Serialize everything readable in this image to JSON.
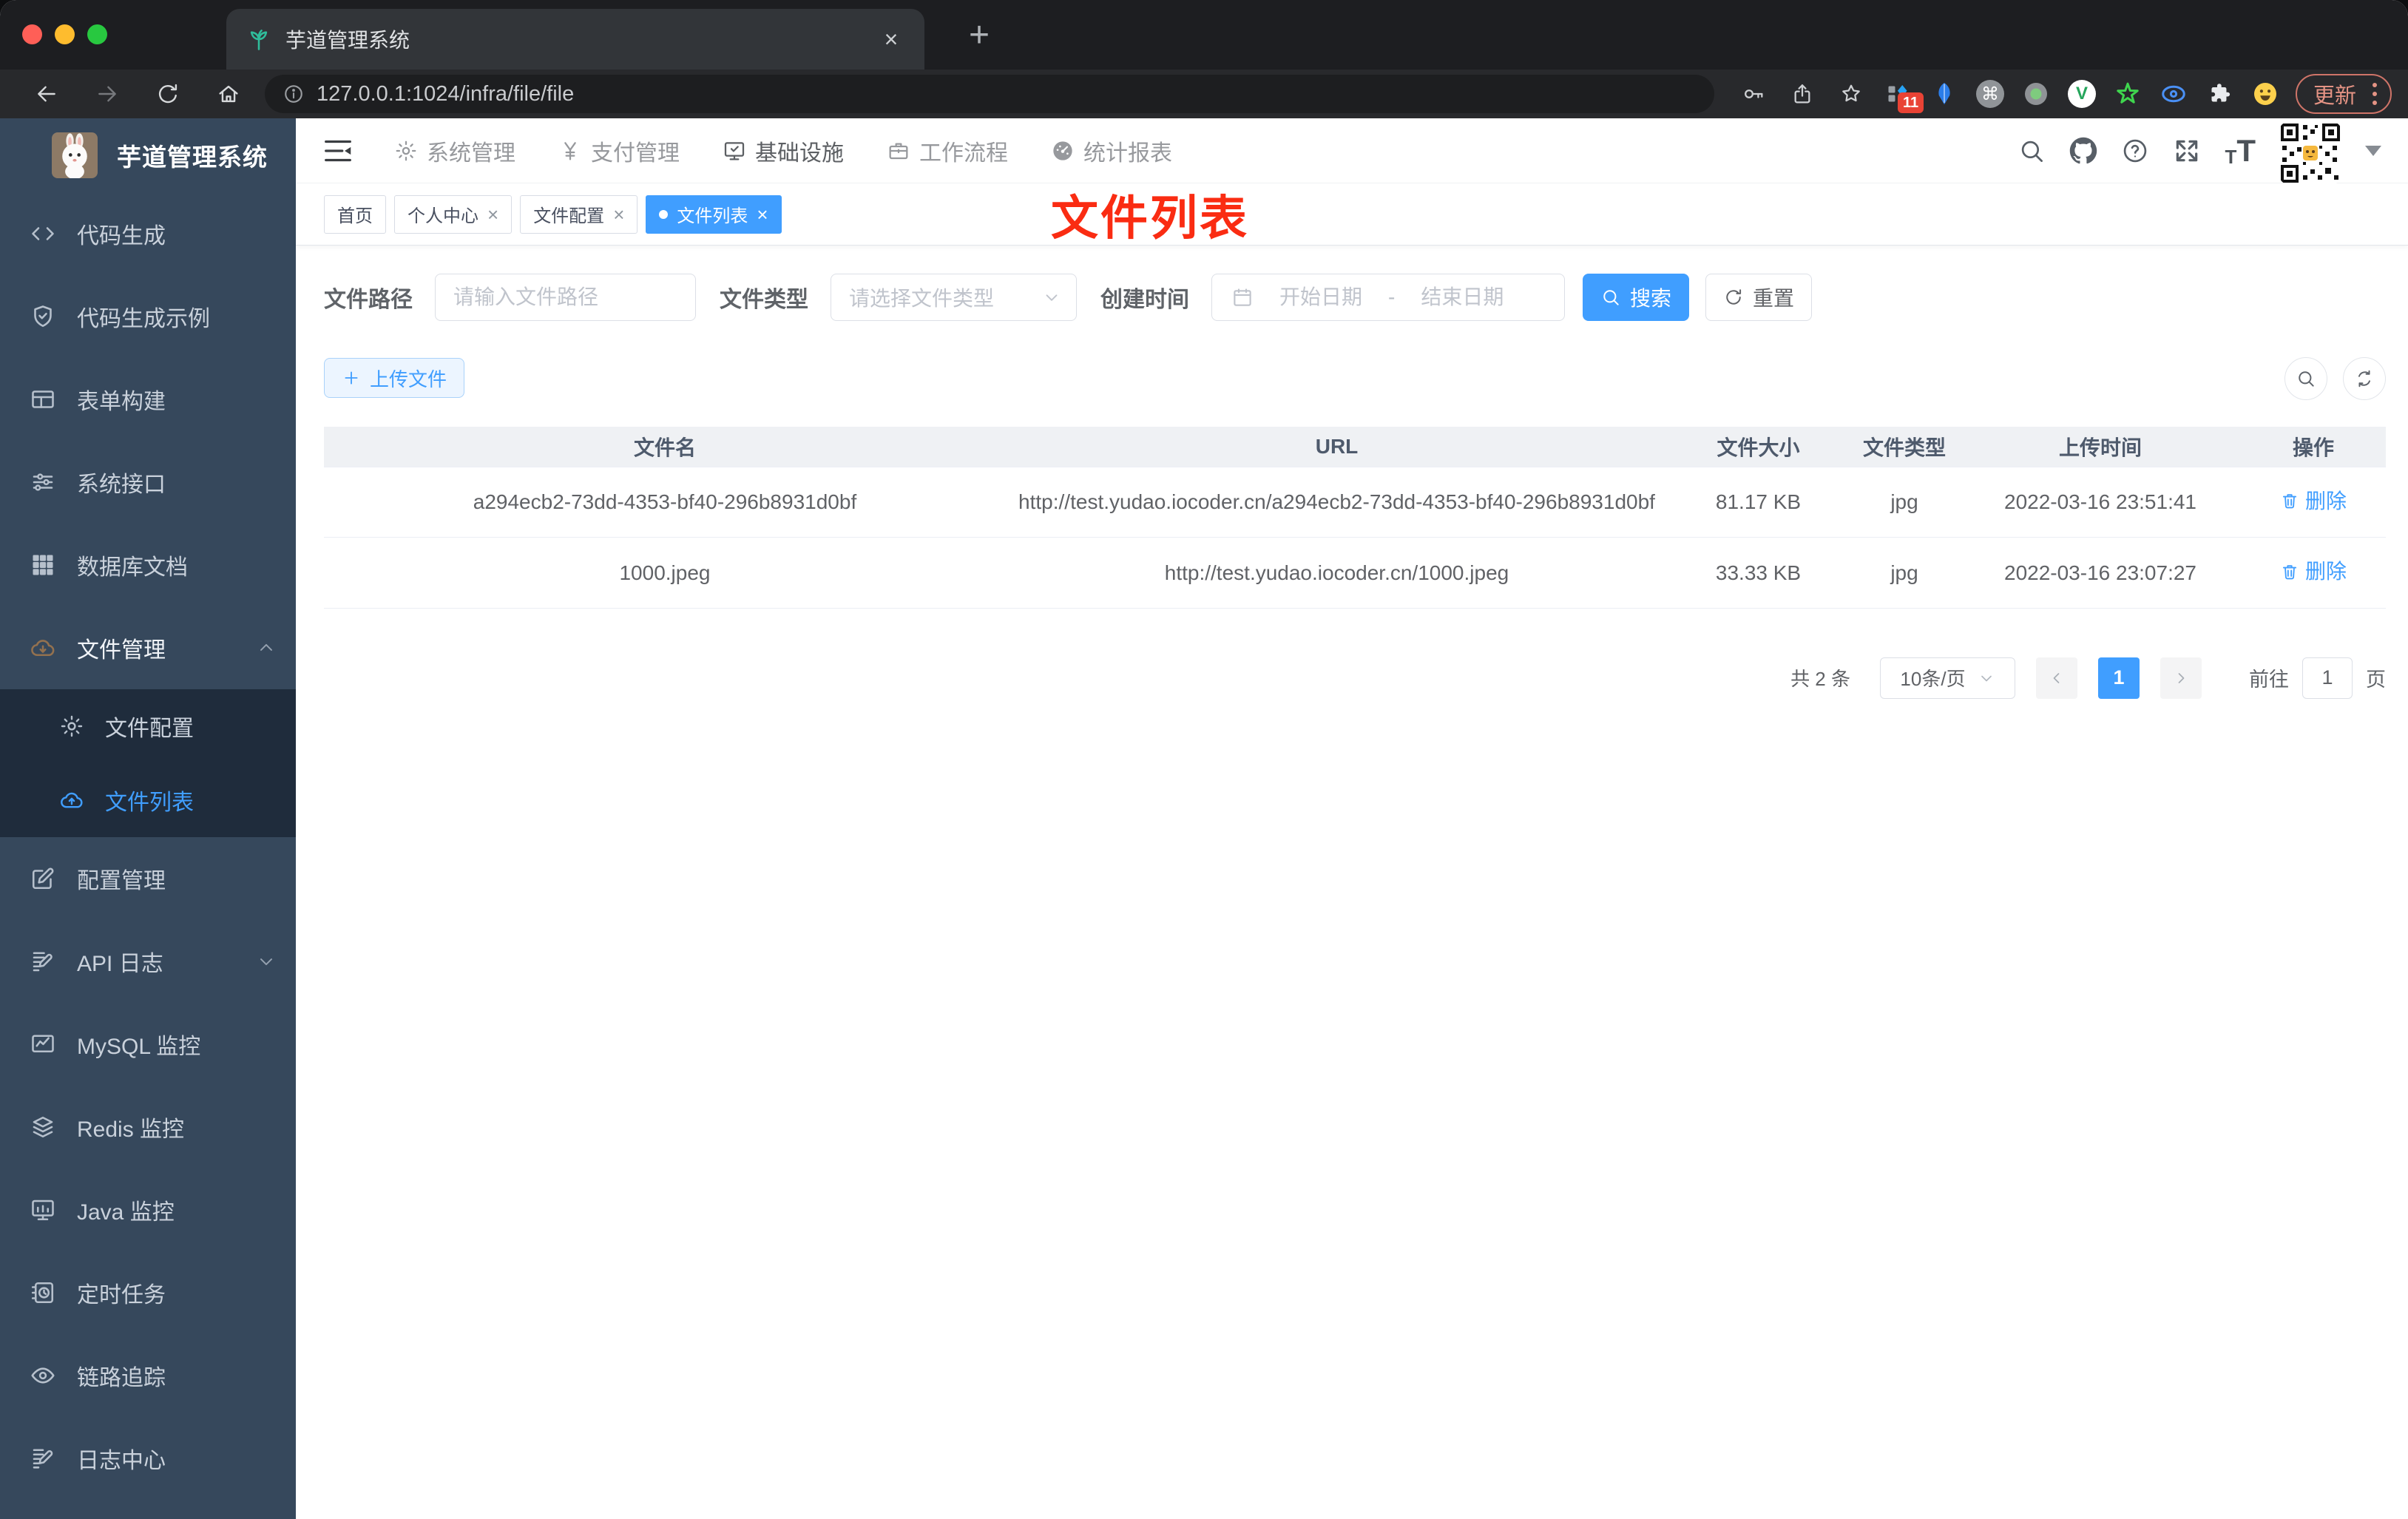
{
  "colors": {
    "accent": "#409eff",
    "annotation_red": "#fa2c12",
    "sidebar_bg": "#36485c",
    "sidebar_submenu_bg": "#1f2c3c",
    "tab_bar_bg": "#1d1e21",
    "upload_button_bg": "#ecf5ff",
    "table_header_bg": "#eff1f4"
  },
  "glyphs": {
    "close": "×",
    "plus": "+",
    "prev": "‹",
    "next": "›",
    "cmd": "⌘",
    "vue": "V",
    "font_small": "T",
    "font_big": "T"
  },
  "browser": {
    "tab_title": "芋道管理系统",
    "url": "127.0.0.1:1024/infra/file/file",
    "extension_badge": "11",
    "update_label": "更新"
  },
  "topnav": {
    "items": [
      {
        "label": "系统管理"
      },
      {
        "label": "支付管理"
      },
      {
        "label": "基础设施"
      },
      {
        "label": "工作流程"
      },
      {
        "label": "统计报表"
      }
    ]
  },
  "sidebar": {
    "title": "芋道管理系统",
    "items": [
      {
        "label": "代码生成"
      },
      {
        "label": "代码生成示例"
      },
      {
        "label": "表单构建"
      },
      {
        "label": "系统接口"
      },
      {
        "label": "数据库文档"
      },
      {
        "label": "文件管理"
      },
      {
        "label": "文件配置"
      },
      {
        "label": "文件列表"
      },
      {
        "label": "配置管理"
      },
      {
        "label": "API 日志"
      },
      {
        "label": "MySQL 监控"
      },
      {
        "label": "Redis 监控"
      },
      {
        "label": "Java 监控"
      },
      {
        "label": "定时任务"
      },
      {
        "label": "链路追踪"
      },
      {
        "label": "日志中心"
      }
    ]
  },
  "tags": {
    "items": [
      {
        "label": "首页"
      },
      {
        "label": "个人中心"
      },
      {
        "label": "文件配置"
      },
      {
        "label": "文件列表"
      }
    ]
  },
  "annotation": "文件列表",
  "filter": {
    "path_label": "文件路径",
    "path_placeholder": "请输入文件路径",
    "type_label": "文件类型",
    "type_placeholder": "请选择文件类型",
    "date_label": "创建时间",
    "date_start_placeholder": "开始日期",
    "date_separator": "-",
    "date_end_placeholder": "结束日期",
    "search_label": "搜索",
    "reset_label": "重置"
  },
  "toolbar": {
    "upload_label": "上传文件"
  },
  "table": {
    "columns": [
      "文件名",
      "URL",
      "文件大小",
      "文件类型",
      "上传时间",
      "操作"
    ],
    "rows": [
      {
        "name": "a294ecb2-73dd-4353-bf40-296b8931d0bf",
        "url": "http://test.yudao.iocoder.cn/a294ecb2-73dd-4353-bf40-296b8931d0bf",
        "size": "81.17 KB",
        "type": "jpg",
        "time": "2022-03-16 23:51:41",
        "action": "删除"
      },
      {
        "name": "1000.jpeg",
        "url": "http://test.yudao.iocoder.cn/1000.jpeg",
        "size": "33.33 KB",
        "type": "jpg",
        "time": "2022-03-16 23:07:27",
        "action": "删除"
      }
    ]
  },
  "pagination": {
    "total": "共 2 条",
    "page_size": "10条/页",
    "page": "1",
    "goto_label": "前往",
    "goto_value": "1",
    "page_unit": "页"
  }
}
